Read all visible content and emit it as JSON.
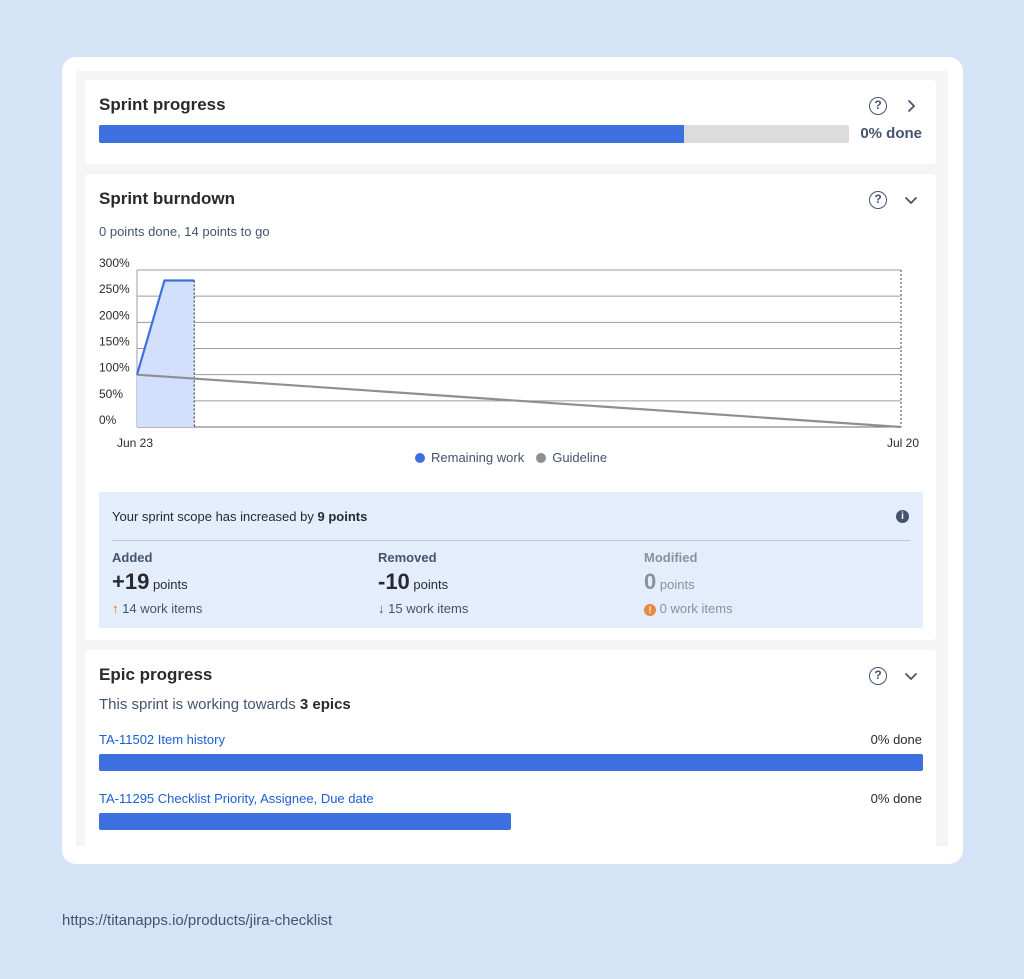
{
  "sprint_progress": {
    "title": "Sprint progress",
    "help_icon": "question-circle-icon",
    "chevron_icon": "chevron-right-icon",
    "progress_fraction": 0.78,
    "done_label": "0% done"
  },
  "sprint_burndown": {
    "title": "Sprint burndown",
    "subtitle": "0 points done, 14 points to go",
    "chevron_icon": "chevron-down-icon",
    "chart_data": {
      "type": "line",
      "y_ticks": [
        "300%",
        "250%",
        "200%",
        "150%",
        "100%",
        "50%",
        "0%"
      ],
      "x_labels": [
        "Jun 23",
        "Jul 20"
      ],
      "ylim": [
        0,
        300
      ],
      "series": [
        {
          "name": "Remaining work",
          "color": "#3e6fe0",
          "points": [
            [
              0,
              100
            ],
            [
              0.036,
              280
            ],
            [
              0.075,
              280
            ]
          ]
        },
        {
          "name": "Guideline",
          "color": "#8c8f96",
          "points": [
            [
              0,
              100
            ],
            [
              1,
              0
            ]
          ]
        }
      ]
    },
    "legend": {
      "remaining": "Remaining work",
      "guideline": "Guideline"
    },
    "scope": {
      "title_prefix": "Your sprint scope has increased by ",
      "title_bold": "9 points",
      "info_icon": "info-icon",
      "added": {
        "label": "Added",
        "value": "+19",
        "unit": "points",
        "items": "14 work items",
        "arrow": "↑"
      },
      "removed": {
        "label": "Removed",
        "value": "-10",
        "unit": "points",
        "items": "15 work items",
        "arrow": "↓"
      },
      "modified": {
        "label": "Modified",
        "value": "0",
        "unit": "points",
        "items": "0 work items",
        "icon": "warning-circle-icon"
      }
    }
  },
  "epic_progress": {
    "title": "Epic progress",
    "subtitle_prefix": "This sprint is working towards ",
    "subtitle_bold": "3 epics",
    "epics": [
      {
        "name": "TA-11502 Item history",
        "done": "0% done",
        "fraction": 1.0
      },
      {
        "name": "TA-11295 Checklist Priority, Assignee, Due date",
        "done": "0% done",
        "fraction": 0.5
      }
    ]
  },
  "footer_url": "https://titanapps.io/products/jira-checklist",
  "colors": {
    "accent": "#3e6fe0",
    "background": "#d5e3f7"
  }
}
